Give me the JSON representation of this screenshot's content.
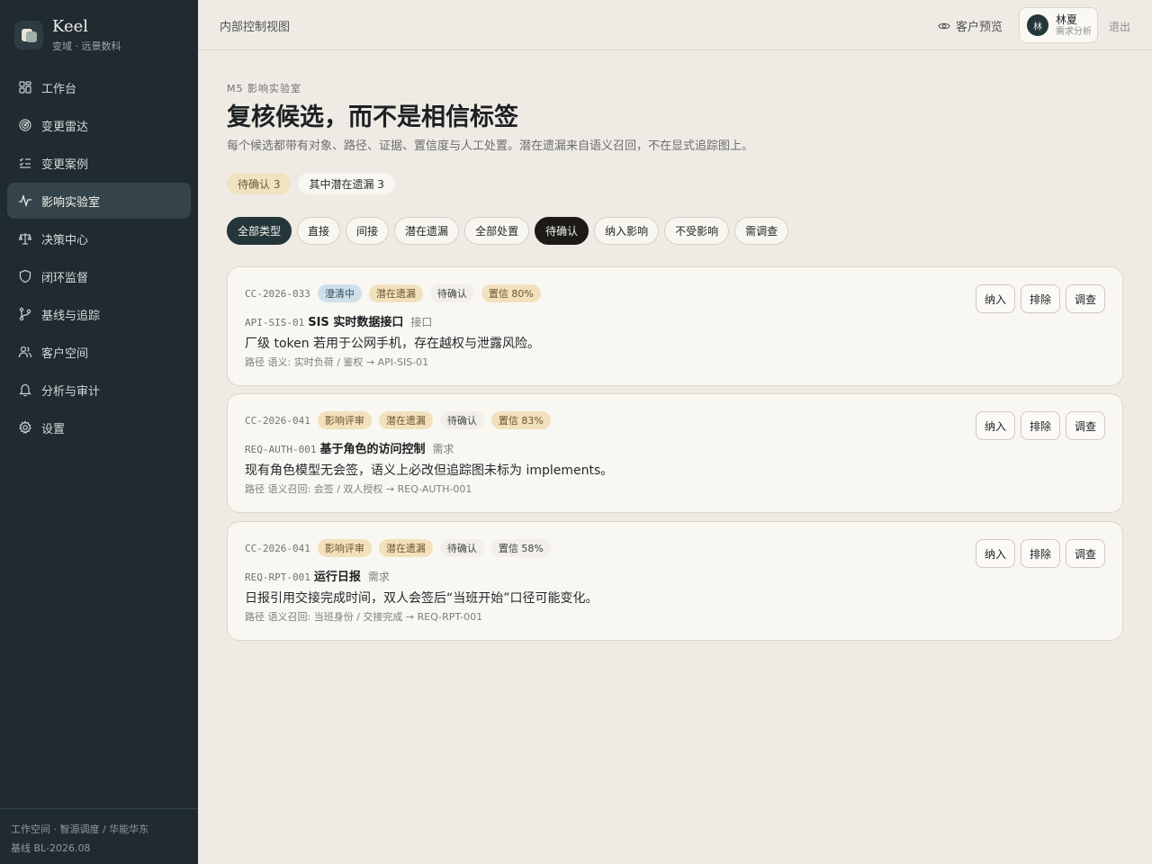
{
  "brand": {
    "name": "Keel",
    "subtitle": "变域 · 远景数科"
  },
  "nav": [
    {
      "label": "工作台",
      "icon": "dashboard-icon"
    },
    {
      "label": "变更雷达",
      "icon": "radar-icon"
    },
    {
      "label": "变更案例",
      "icon": "checklist-icon"
    },
    {
      "label": "影响实验室",
      "icon": "activity-icon",
      "active": true
    },
    {
      "label": "决策中心",
      "icon": "scale-icon"
    },
    {
      "label": "闭环监督",
      "icon": "shield-icon"
    },
    {
      "label": "基线与追踪",
      "icon": "branch-icon"
    },
    {
      "label": "客户空间",
      "icon": "users-icon"
    },
    {
      "label": "分析与审计",
      "icon": "bell-icon"
    },
    {
      "label": "设置",
      "icon": "gear-icon"
    }
  ],
  "footer": {
    "workspace": "工作空间 · 智源调度 / 华能华东",
    "baseline": "基线 BL-2026.08"
  },
  "topbar": {
    "title": "内部控制视图",
    "preview_label": "客户预览",
    "user": {
      "avatar": "林",
      "name": "林夏",
      "role": "需求分析"
    },
    "logout": "退出"
  },
  "main": {
    "eyebrow": "M5 影响实验室",
    "title": "复核候选，而不是相信标签",
    "subtitle": "每个候选都带有对象、路径、证据、置信度与人工处置。潜在遗漏来自语义召回，不在显式追踪图上。",
    "summary": [
      "待确认 3",
      "其中潜在遗漏 3"
    ],
    "filters": [
      "全部类型",
      "直接",
      "间接",
      "潜在遗漏",
      "全部处置",
      "待确认",
      "纳入影响",
      "不受影响",
      "需调查"
    ],
    "actions": {
      "include": "纳入",
      "exclude": "排除",
      "investigate": "调查"
    },
    "cards": [
      {
        "case": "CC-2026-033",
        "tags": [
          {
            "text": "澄清中",
            "style": "blue"
          },
          {
            "text": "潜在遗漏",
            "style": "amber"
          },
          {
            "text": "待确认",
            "style": "gray"
          },
          {
            "text": "置信 80%",
            "style": "amber"
          }
        ],
        "obj_id": "API-SIS-01",
        "obj_name": "SIS 实时数据接口",
        "obj_type": "接口",
        "desc": "厂级 token 若用于公网手机，存在越权与泄露风险。",
        "path": "路径 语义: 实时负荷 / 鉴权 → API-SIS-01"
      },
      {
        "case": "CC-2026-041",
        "tags": [
          {
            "text": "影响评审",
            "style": "amber"
          },
          {
            "text": "潜在遗漏",
            "style": "amber"
          },
          {
            "text": "待确认",
            "style": "gray"
          },
          {
            "text": "置信 83%",
            "style": "amber"
          }
        ],
        "obj_id": "REQ-AUTH-001",
        "obj_name": "基于角色的访问控制",
        "obj_type": "需求",
        "desc": "现有角色模型无会签，语义上必改但追踪图未标为 implements。",
        "path": "路径 语义召回: 会签 / 双人授权 → REQ-AUTH-001"
      },
      {
        "case": "CC-2026-041",
        "tags": [
          {
            "text": "影响评审",
            "style": "amber"
          },
          {
            "text": "潜在遗漏",
            "style": "amber"
          },
          {
            "text": "待确认",
            "style": "gray"
          },
          {
            "text": "置信 58%",
            "style": "gray"
          }
        ],
        "obj_id": "REQ-RPT-001",
        "obj_name": "运行日报",
        "obj_type": "需求",
        "desc": "日报引用交接完成时间，双人会签后“当班开始”口径可能变化。",
        "path": "路径 语义召回: 当班身份 / 交接完成 → REQ-RPT-001"
      }
    ]
  }
}
